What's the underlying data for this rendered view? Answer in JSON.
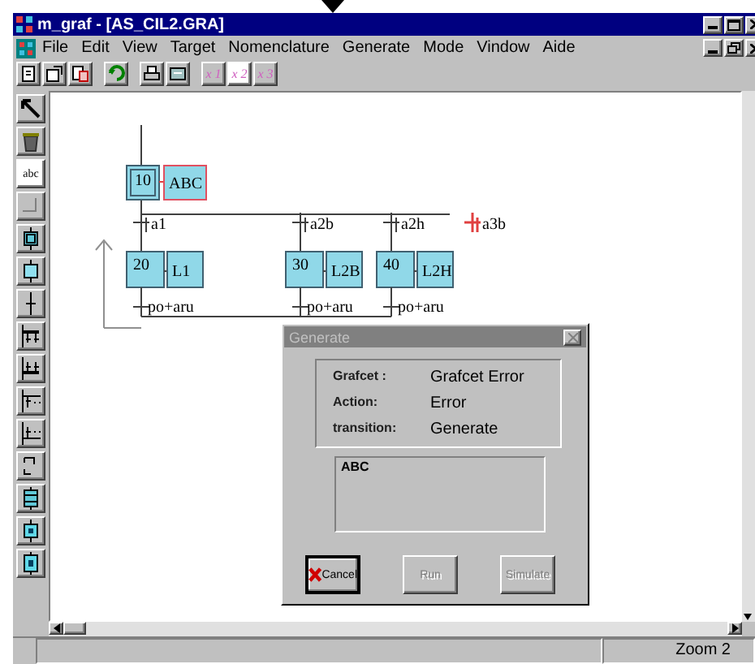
{
  "window": {
    "title": "m_graf - [AS_CIL2.GRA]"
  },
  "menu": [
    "File",
    "Edit",
    "View",
    "Target",
    "Nomenclature",
    "Generate",
    "Mode",
    "Vindow",
    "Aide"
  ],
  "toolbar": {
    "zoom_buttons": [
      {
        "label": "x 1",
        "selected": false
      },
      {
        "label": "x 2",
        "selected": true
      },
      {
        "label": "x 3",
        "selected": false
      }
    ]
  },
  "toolbox": [
    {
      "kind": "pointer",
      "selected": false
    },
    {
      "kind": "trash",
      "selected": false
    },
    {
      "kind": "text",
      "label": "abc",
      "selected": true
    },
    {
      "kind": "link",
      "selected": false
    },
    {
      "kind": "initial-step",
      "selected": false
    },
    {
      "kind": "step",
      "selected": false
    },
    {
      "kind": "transition",
      "selected": false
    },
    {
      "kind": "and-divergence",
      "selected": false
    },
    {
      "kind": "and-convergence",
      "selected": false
    },
    {
      "kind": "or-divergence",
      "selected": false
    },
    {
      "kind": "or-convergence",
      "selected": false
    },
    {
      "kind": "jump",
      "selected": false
    },
    {
      "kind": "macro-step",
      "selected": false
    },
    {
      "kind": "action-step",
      "selected": false
    },
    {
      "kind": "small-step",
      "selected": false
    }
  ],
  "diagram": {
    "initial_step": {
      "number": "10",
      "action": "ABC",
      "error": true
    },
    "transitions": [
      {
        "label": "a1",
        "error": false
      },
      {
        "label": "a2b",
        "error": false
      },
      {
        "label": "a2h",
        "error": false
      },
      {
        "label": "a3b",
        "error": true
      }
    ],
    "steps": [
      {
        "number": "20",
        "action": "L1"
      },
      {
        "number": "30",
        "action": "L2B"
      },
      {
        "number": "40",
        "action": "L2H"
      }
    ],
    "exit_transitions": [
      {
        "label": "po+aru"
      },
      {
        "label": "po+aru"
      },
      {
        "label": "po+aru"
      }
    ]
  },
  "dialog": {
    "title": "Generate",
    "fields": [
      {
        "label": "Grafcet :",
        "value": "Grafcet Error"
      },
      {
        "label": "Action:",
        "value": "Error"
      },
      {
        "label": "transition:",
        "value": "Generate"
      }
    ],
    "message": "ABC",
    "buttons": [
      {
        "label": "Cancel",
        "kind": "cancel",
        "disabled": false
      },
      {
        "label": "Run",
        "kind": "plain",
        "disabled": true
      },
      {
        "label": "Simulate",
        "kind": "plain",
        "disabled": true
      }
    ]
  },
  "status_bar": {
    "zoom": "Zoom 2"
  }
}
